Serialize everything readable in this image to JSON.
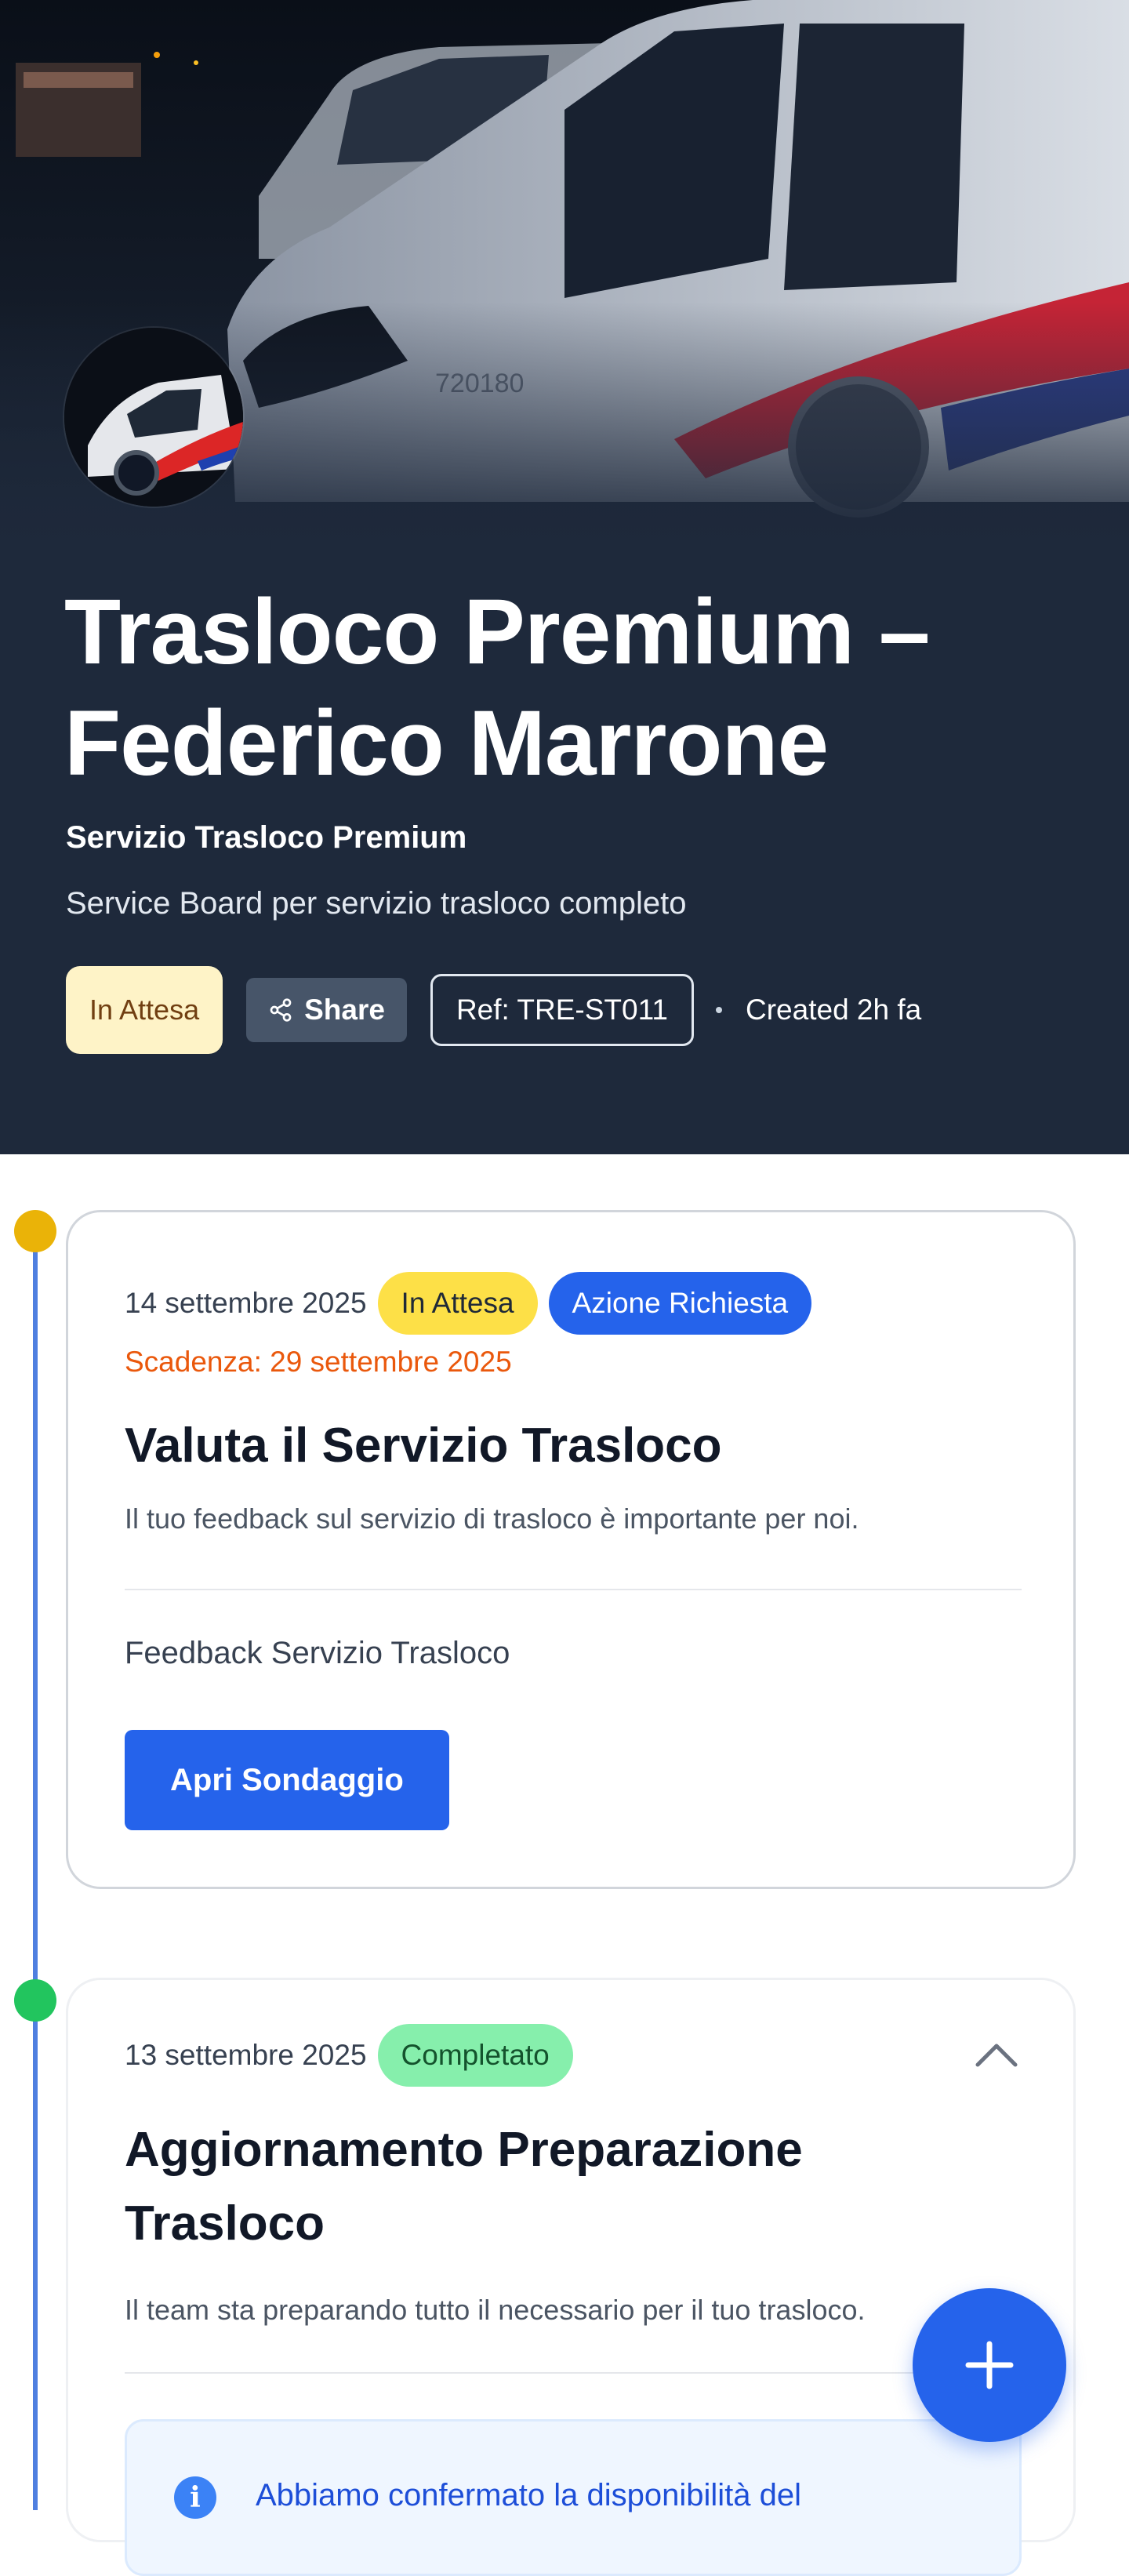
{
  "header": {
    "title": "Trasloco Premium – Federico Marrone",
    "service_name": "Servizio Trasloco Premium",
    "description": "Service Board per servizio trasloco completo",
    "status": "In Attesa",
    "share_label": "Share",
    "reference": "Ref: TRE-ST011",
    "created": "Created 2h fa",
    "van_plate": "720180"
  },
  "timeline": [
    {
      "date": "14 settembre 2025",
      "status": "In Attesa",
      "action_tag": "Azione Richiesta",
      "deadline": "Scadenza: 29 settembre 2025",
      "title": "Valuta il Servizio Trasloco",
      "description": "Il tuo feedback sul servizio di trasloco è importante per noi.",
      "section_label": "Feedback Servizio Trasloco",
      "button_label": "Apri Sondaggio",
      "dot_color": "#eab308"
    },
    {
      "date": "13 settembre 2025",
      "status": "Completato",
      "title": "Aggiornamento Preparazione Trasloco",
      "description": "Il team sta preparando tutto il necessario per il tuo trasloco.",
      "info_text": "Abbiamo confermato la disponibilità del",
      "dot_color": "#22c55e"
    }
  ],
  "icons": {
    "share": "share-icon",
    "chevron": "chevron-up-icon",
    "info": "info-icon",
    "fab": "plus-icon"
  },
  "colors": {
    "hero_bg": "#1e293b",
    "accent": "#2563eb",
    "timeline_line": "#4f7fe0",
    "deadline": "#ea580c"
  }
}
